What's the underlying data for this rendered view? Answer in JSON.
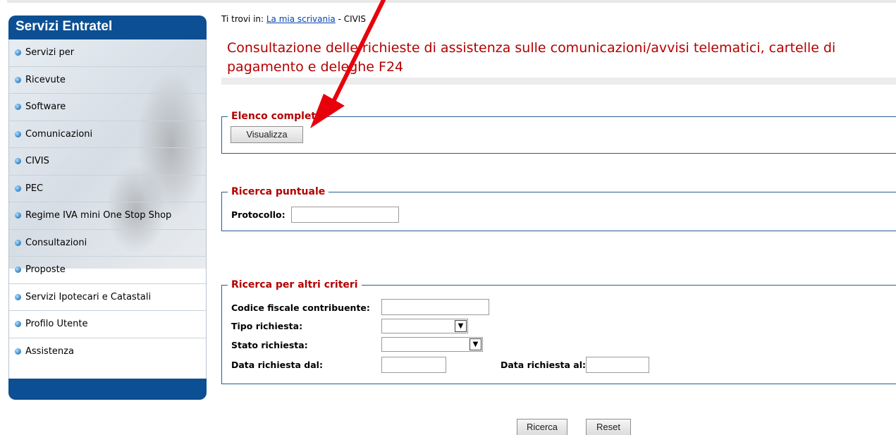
{
  "sidebar": {
    "title": "Servizi Entratel",
    "items": [
      {
        "label": "Servizi per"
      },
      {
        "label": "Ricevute"
      },
      {
        "label": "Software"
      },
      {
        "label": "Comunicazioni"
      },
      {
        "label": "CIVIS"
      },
      {
        "label": "PEC"
      },
      {
        "label": "Regime IVA mini One Stop Shop"
      },
      {
        "label": "Consultazioni"
      },
      {
        "label": "Proposte"
      },
      {
        "label": "Servizi Ipotecari e Catastali"
      },
      {
        "label": "Profilo Utente"
      },
      {
        "label": "Assistenza"
      }
    ]
  },
  "breadcrumb": {
    "prefix": "Ti trovi in: ",
    "link": "La mia scrivania",
    "separator": " - ",
    "current": "CIVIS"
  },
  "page": {
    "title": "Consultazione delle richieste di assistenza sulle comunicazioni/avvisi telematici, cartelle di pagamento e deleghe F24"
  },
  "elenco": {
    "legend": "Elenco completo",
    "button": "Visualizza"
  },
  "puntuale": {
    "legend": "Ricerca puntuale",
    "protocollo_label": "Protocollo:"
  },
  "altri": {
    "legend": "Ricerca per altri criteri",
    "cf_label": "Codice fiscale contribuente:",
    "tipo_label": "Tipo richiesta:",
    "stato_label": "Stato richiesta:",
    "dal_label": "Data richiesta dal:",
    "al_label": "Data richiesta al:"
  },
  "actions": {
    "ricerca": "Ricerca",
    "reset": "Reset"
  },
  "colors": {
    "sidebar_blue": "#0c4f93",
    "title_red": "#b40000",
    "annotation_arrow": "#e8000a"
  }
}
